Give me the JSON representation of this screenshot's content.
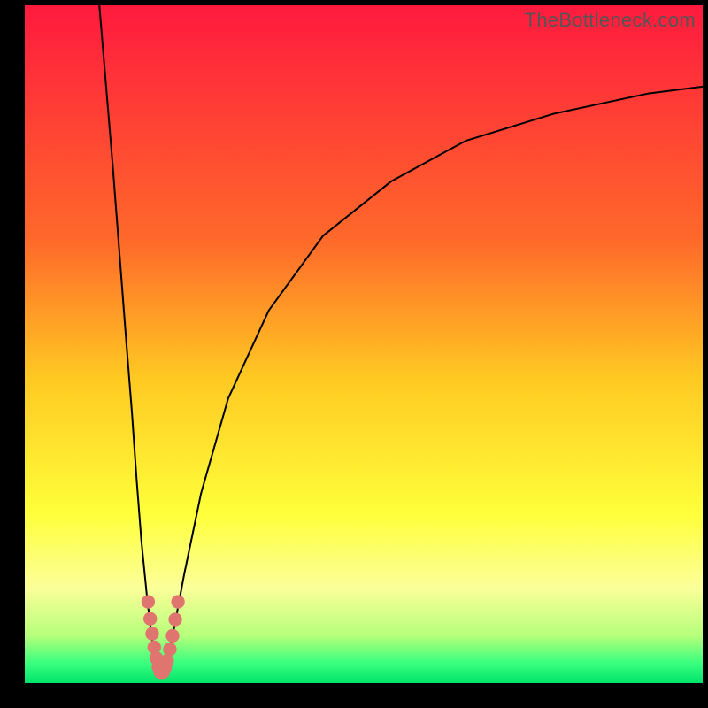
{
  "watermark": "TheBottleneck.com",
  "chart_data": {
    "type": "line",
    "title": "",
    "xlabel": "",
    "ylabel": "",
    "xlim": [
      0,
      100
    ],
    "ylim": [
      0,
      100
    ],
    "grid": false,
    "background_gradient": {
      "stops": [
        {
          "offset": 0.0,
          "color": "#ff1a3e"
        },
        {
          "offset": 0.35,
          "color": "#ff6a2a"
        },
        {
          "offset": 0.55,
          "color": "#ffc922"
        },
        {
          "offset": 0.75,
          "color": "#ffff3a"
        },
        {
          "offset": 0.86,
          "color": "#fbff9a"
        },
        {
          "offset": 0.93,
          "color": "#b6ff7a"
        },
        {
          "offset": 0.97,
          "color": "#3aff7e"
        },
        {
          "offset": 1.0,
          "color": "#00e36b"
        }
      ]
    },
    "series": [
      {
        "name": "curve-left",
        "color": "#000000",
        "x": [
          11.0,
          12.0,
          13.0,
          14.0,
          15.0,
          15.8,
          16.5,
          17.2,
          18.0,
          18.7,
          19.3
        ],
        "y": [
          100.0,
          88.0,
          76.0,
          63.0,
          50.0,
          40.0,
          30.0,
          21.0,
          13.0,
          7.0,
          3.0
        ]
      },
      {
        "name": "curve-right",
        "color": "#000000",
        "x": [
          21.0,
          22.0,
          23.5,
          26.0,
          30.0,
          36.0,
          44.0,
          54.0,
          65.0,
          78.0,
          92.0,
          100.0
        ],
        "y": [
          3.0,
          8.0,
          16.0,
          28.0,
          42.0,
          55.0,
          66.0,
          74.0,
          80.0,
          84.0,
          87.0,
          88.0
        ]
      },
      {
        "name": "valley-bottom",
        "color": "#000000",
        "x": [
          19.3,
          19.7,
          20.1,
          20.5,
          21.0
        ],
        "y": [
          3.0,
          1.6,
          1.2,
          1.6,
          3.0
        ]
      }
    ],
    "markers": {
      "name": "valley-markers",
      "color": "#e0746e",
      "radius": 1.0,
      "points": [
        {
          "x": 18.2,
          "y": 12.0
        },
        {
          "x": 18.5,
          "y": 9.5
        },
        {
          "x": 18.8,
          "y": 7.3
        },
        {
          "x": 19.1,
          "y": 5.3
        },
        {
          "x": 19.4,
          "y": 3.7
        },
        {
          "x": 19.7,
          "y": 2.4
        },
        {
          "x": 20.0,
          "y": 1.6
        },
        {
          "x": 20.4,
          "y": 1.6
        },
        {
          "x": 20.7,
          "y": 2.3
        },
        {
          "x": 21.0,
          "y": 3.3
        },
        {
          "x": 21.4,
          "y": 5.0
        },
        {
          "x": 21.8,
          "y": 7.0
        },
        {
          "x": 22.2,
          "y": 9.4
        },
        {
          "x": 22.6,
          "y": 12.0
        }
      ]
    }
  }
}
